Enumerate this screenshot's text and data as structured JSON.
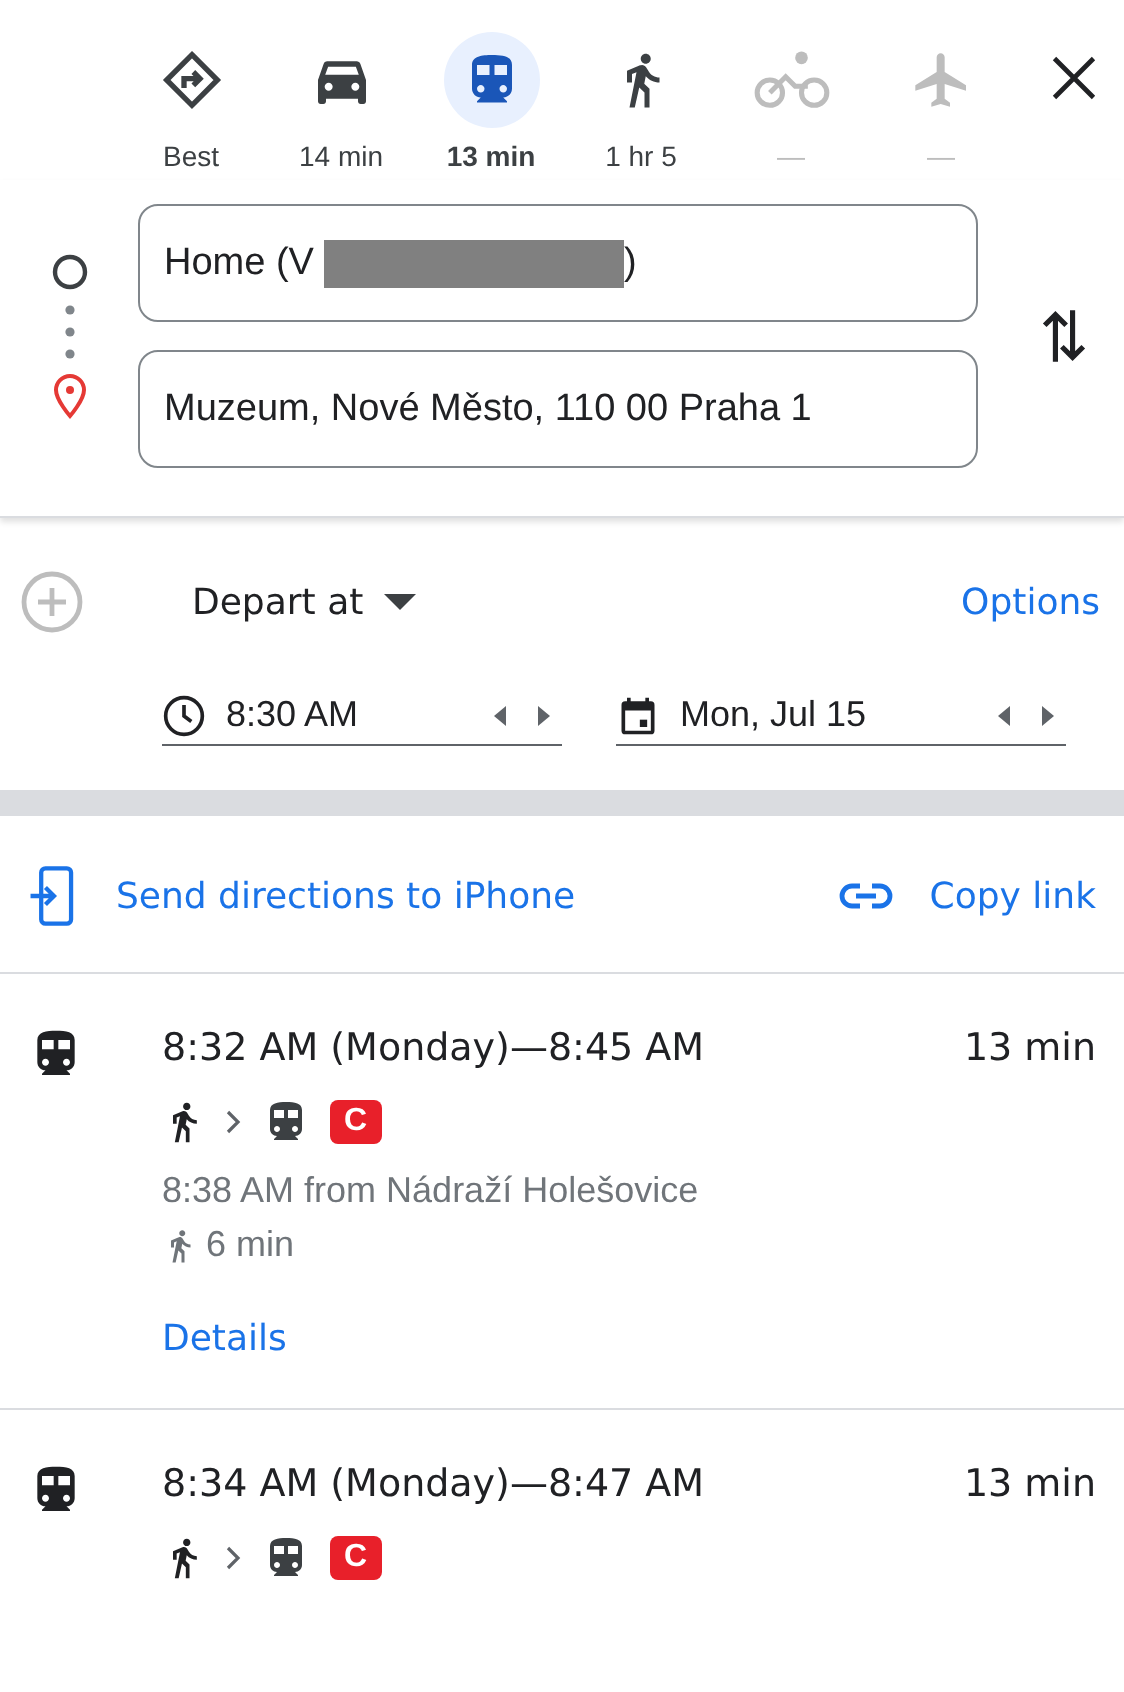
{
  "modes": [
    {
      "kind": "best",
      "label": "Best",
      "selected": false,
      "disabled": false
    },
    {
      "kind": "car",
      "label": "14 min",
      "selected": false,
      "disabled": false
    },
    {
      "kind": "transit",
      "label": "13 min",
      "selected": true,
      "disabled": false
    },
    {
      "kind": "walk",
      "label": "1 hr 5",
      "selected": false,
      "disabled": false
    },
    {
      "kind": "bike",
      "label": "—",
      "selected": false,
      "disabled": true
    },
    {
      "kind": "flight",
      "label": "—",
      "selected": false,
      "disabled": true
    }
  ],
  "origin": {
    "prefix": "Home (V",
    "redacted": true,
    "suffix": ")"
  },
  "destination": {
    "value": "Muzeum, Nové Město, 110 00 Praha 1"
  },
  "depart": {
    "label": "Depart at",
    "options": "Options",
    "time": "8:30 AM",
    "date": "Mon, Jul 15"
  },
  "share": {
    "send": "Send directions to iPhone",
    "copy": "Copy link"
  },
  "routes": [
    {
      "times": "8:32 AM (Monday)—8:45 AM",
      "duration": "13 min",
      "steps": [
        {
          "kind": "walk"
        },
        {
          "kind": "tram",
          "line": "C",
          "color": "#e8202a"
        }
      ],
      "departure": "8:38 AM from Nádraží Holešovice",
      "walk": "6 min",
      "details": "Details"
    },
    {
      "times": "8:34 AM (Monday)—8:47 AM",
      "duration": "13 min",
      "steps": [
        {
          "kind": "walk"
        },
        {
          "kind": "tram",
          "line": "C",
          "color": "#e8202a"
        }
      ]
    }
  ]
}
